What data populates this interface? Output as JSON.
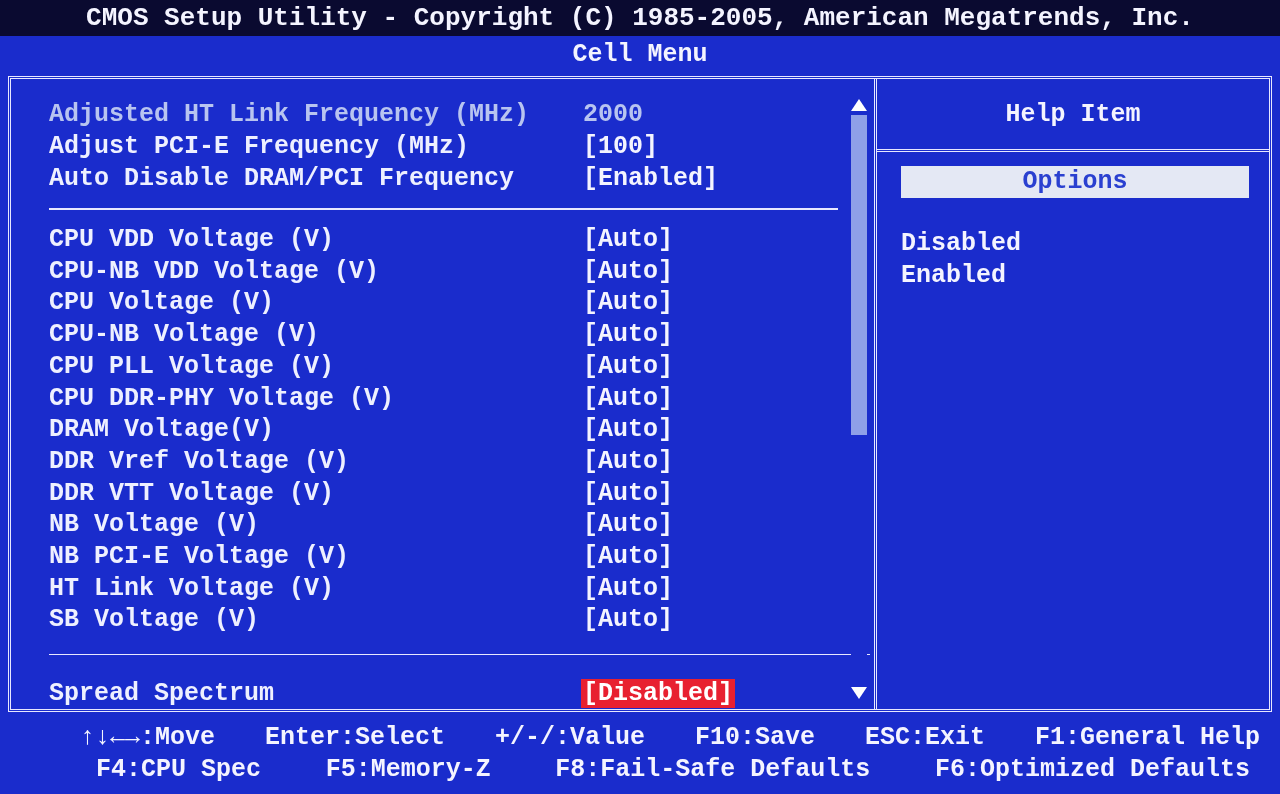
{
  "header": {
    "title": "CMOS Setup Utility - Copyright (C) 1985-2005, American Megatrends, Inc.",
    "menu": "Cell Menu"
  },
  "settings": [
    [
      {
        "label": "Adjusted HT Link Frequency (MHz)",
        "value": "2000",
        "disabled": true,
        "selected": false
      },
      {
        "label": "Adjust PCI-E Frequency (MHz)",
        "value": "[100]",
        "disabled": false,
        "selected": false
      },
      {
        "label": "Auto Disable DRAM/PCI Frequency",
        "value": "[Enabled]",
        "disabled": false,
        "selected": false
      }
    ],
    [
      {
        "label": "CPU VDD Voltage (V)",
        "value": "[Auto]",
        "disabled": false,
        "selected": false
      },
      {
        "label": "CPU-NB VDD Voltage (V)",
        "value": "[Auto]",
        "disabled": false,
        "selected": false
      },
      {
        "label": "CPU Voltage (V)",
        "value": "[Auto]",
        "disabled": false,
        "selected": false
      },
      {
        "label": "CPU-NB Voltage (V)",
        "value": "[Auto]",
        "disabled": false,
        "selected": false
      },
      {
        "label": "CPU PLL Voltage (V)",
        "value": "[Auto]",
        "disabled": false,
        "selected": false
      },
      {
        "label": "CPU DDR-PHY Voltage (V)",
        "value": "[Auto]",
        "disabled": false,
        "selected": false
      },
      {
        "label": "DRAM Voltage(V)",
        "value": "[Auto]",
        "disabled": false,
        "selected": false
      },
      {
        "label": "DDR Vref Voltage (V)",
        "value": "[Auto]",
        "disabled": false,
        "selected": false
      },
      {
        "label": "DDR VTT Voltage (V)",
        "value": "[Auto]",
        "disabled": false,
        "selected": false
      },
      {
        "label": "NB Voltage (V)",
        "value": "[Auto]",
        "disabled": false,
        "selected": false
      },
      {
        "label": "NB PCI-E Voltage (V)",
        "value": "[Auto]",
        "disabled": false,
        "selected": false
      },
      {
        "label": "HT Link Voltage (V)",
        "value": "[Auto]",
        "disabled": false,
        "selected": false
      },
      {
        "label": "SB Voltage (V)",
        "value": "[Auto]",
        "disabled": false,
        "selected": false
      }
    ],
    [
      {
        "label": "Spread Spectrum",
        "value": "[Disabled]",
        "disabled": false,
        "selected": true
      }
    ]
  ],
  "help": {
    "title": "Help Item",
    "options_label": "Options",
    "options": [
      "Disabled",
      "Enabled"
    ]
  },
  "footer": [
    [
      "↑↓←→:Move",
      "Enter:Select",
      "+/-/:Value",
      "F10:Save",
      "ESC:Exit",
      "F1:General Help"
    ],
    [
      "F4:CPU Spec",
      "F5:Memory-Z",
      "F8:Fail-Safe Defaults",
      "F6:Optimized Defaults"
    ]
  ]
}
